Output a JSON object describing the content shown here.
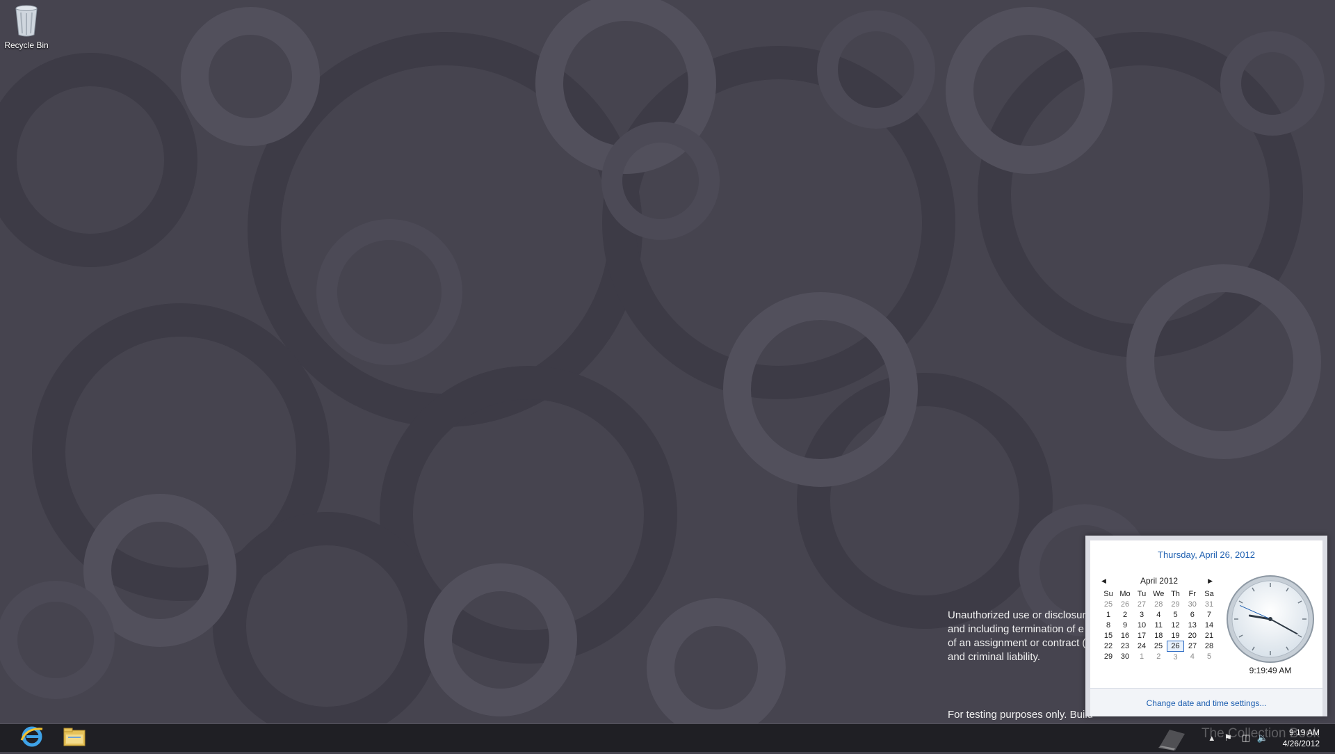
{
  "desktop": {
    "icons": [
      {
        "label": "Recycle Bin",
        "icon": "recycle-bin-icon"
      }
    ],
    "legal_notice": [
      "Unauthorized use or disclosure",
      "and including termination of e",
      "of an assignment or contract (",
      "and criminal liability."
    ],
    "build_notice": "For testing purposes only. Build"
  },
  "taskbar": {
    "pinned": [
      {
        "name": "Internet Explorer",
        "icon": "internet-explorer-icon"
      },
      {
        "name": "File Explorer",
        "icon": "file-explorer-icon"
      }
    ],
    "tray": {
      "time": "9:19 AM",
      "date": "4/26/2012",
      "watermark": "The Collection Book"
    }
  },
  "flyout": {
    "date_long": "Thursday, April 26, 2012",
    "month_label": "April 2012",
    "weekdays": [
      "Su",
      "Mo",
      "Tu",
      "We",
      "Th",
      "Fr",
      "Sa"
    ],
    "weeks": [
      [
        "25",
        "26",
        "27",
        "28",
        "29",
        "30",
        "31"
      ],
      [
        "1",
        "2",
        "3",
        "4",
        "5",
        "6",
        "7"
      ],
      [
        "8",
        "9",
        "10",
        "11",
        "12",
        "13",
        "14"
      ],
      [
        "15",
        "16",
        "17",
        "18",
        "19",
        "20",
        "21"
      ],
      [
        "22",
        "23",
        "24",
        "25",
        "26",
        "27",
        "28"
      ],
      [
        "29",
        "30",
        "1",
        "2",
        "3",
        "4",
        "5"
      ]
    ],
    "today_row": 4,
    "today_col": 4,
    "clock_time": "9:19:49 AM",
    "clock_hands": {
      "hours": 9,
      "minutes": 19,
      "seconds": 49
    },
    "change_link": "Change date and time settings..."
  },
  "colors": {
    "accent_blue": "#1e5fb0",
    "wallpaper": "#46444f",
    "taskbar": "#1f1f24"
  }
}
